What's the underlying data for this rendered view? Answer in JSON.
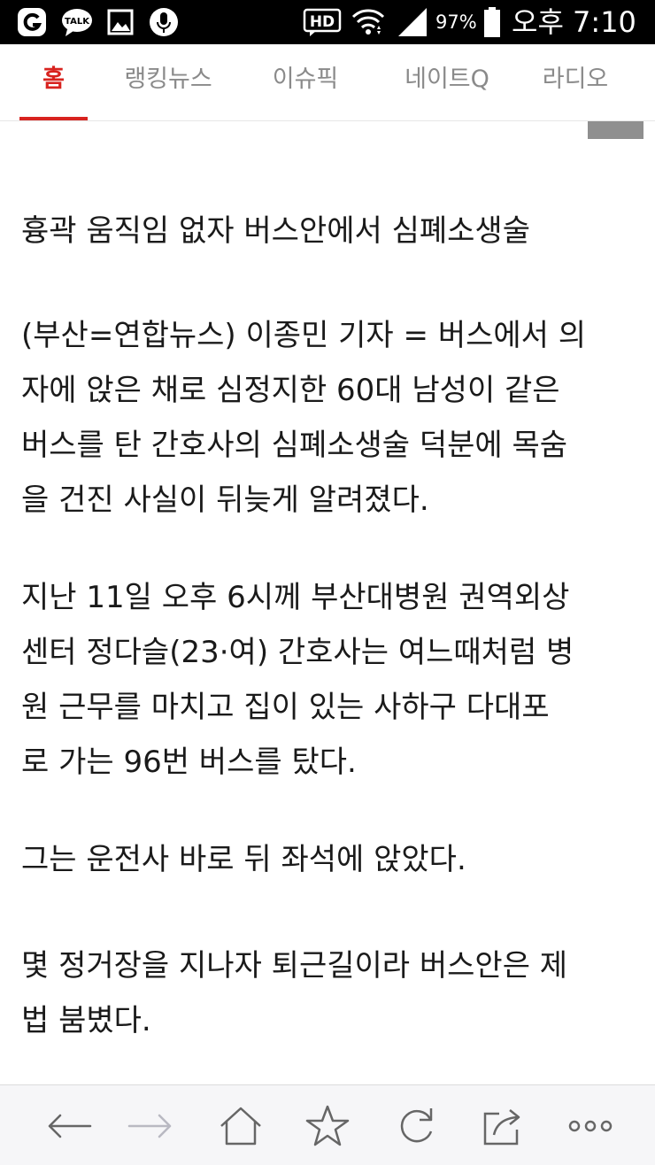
{
  "status_bar": {
    "talk_label": "TALK",
    "hd_label": "HD",
    "battery_percent": "97%",
    "time": "오후 7:10",
    "icons": [
      "app-g-icon",
      "kakaotalk-icon",
      "gallery-icon",
      "microphone-icon",
      "hd-voice-icon",
      "wifi-icon",
      "signal-icon",
      "battery-icon"
    ]
  },
  "tabs": [
    {
      "label": "홈",
      "active": true
    },
    {
      "label": "랭킹뉴스",
      "active": false
    },
    {
      "label": "이슈픽",
      "active": false
    },
    {
      "label": "네이트Q",
      "active": false
    },
    {
      "label": "라디오",
      "active": false
    }
  ],
  "article": {
    "headline": "흉곽 움직임 없자 버스안에서 심폐소생술",
    "paragraphs": [
      [
        "(부산=연합뉴스) 이종민 기자 = 버스에서 의",
        "자에 앉은 채로 심정지한 60대 남성이 같은",
        "버스를 탄 간호사의 심폐소생술 덕분에 목숨",
        "을 건진 사실이 뒤늦게 알려졌다."
      ],
      [
        "지난 11일 오후 6시께 부산대병원 권역외상",
        "센터 정다슬(23·여) 간호사는 여느때처럼 병",
        "원 근무를 마치고 집이 있는 사하구 다대포",
        "로 가는 96번 버스를 탔다."
      ],
      [
        "그는 운전사 바로 뒤 좌석에 앉았다."
      ],
      [
        "몇 정거장을 지나자 퇴근길이라 버스안은 제",
        "법 붐볐다."
      ]
    ]
  },
  "toolbar": {
    "buttons": [
      "back-icon",
      "forward-icon",
      "home-icon",
      "bookmark-star-icon",
      "refresh-icon",
      "share-icon",
      "more-icon"
    ]
  },
  "colors": {
    "accent": "#d8231f",
    "tab_inactive": "#8a8a8a",
    "text": "#1a1a1a",
    "status_bar_bg": "#000000",
    "toolbar_bg": "#f6f6f8"
  }
}
